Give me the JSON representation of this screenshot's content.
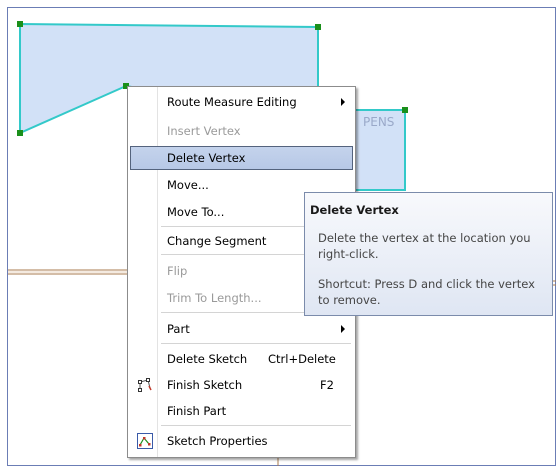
{
  "map": {
    "feature_label": "PENS"
  },
  "context_menu": {
    "items": [
      {
        "label": "Route Measure Editing",
        "submenu": true
      },
      {
        "label": "Insert Vertex",
        "disabled": true
      },
      {
        "label": "Delete Vertex",
        "highlighted": true
      },
      {
        "label": "Move..."
      },
      {
        "label": "Move To..."
      },
      {
        "label": "Change Segment",
        "submenu": true
      },
      {
        "label": "Flip",
        "disabled": true
      },
      {
        "label": "Trim To Length...",
        "disabled": true
      },
      {
        "label": "Part",
        "submenu": true
      },
      {
        "label": "Delete Sketch",
        "shortcut": "Ctrl+Delete"
      },
      {
        "label": "Finish Sketch",
        "shortcut": "F2",
        "icon": "finish-sketch-icon"
      },
      {
        "label": "Finish Part"
      },
      {
        "label": "Sketch Properties",
        "icon": "sketch-properties-icon"
      }
    ]
  },
  "tooltip": {
    "title": "Delete Vertex",
    "description": "Delete the vertex at the location you right-click.",
    "shortcut": "Shortcut: Press D and click the vertex to remove."
  },
  "colors": {
    "polygon_fill": "#d2e1f7",
    "polygon_outline": "#33c9c9",
    "vertex": "#1a8f1a",
    "road_line": "#a87b4f",
    "highlight_border": "#54637d"
  }
}
